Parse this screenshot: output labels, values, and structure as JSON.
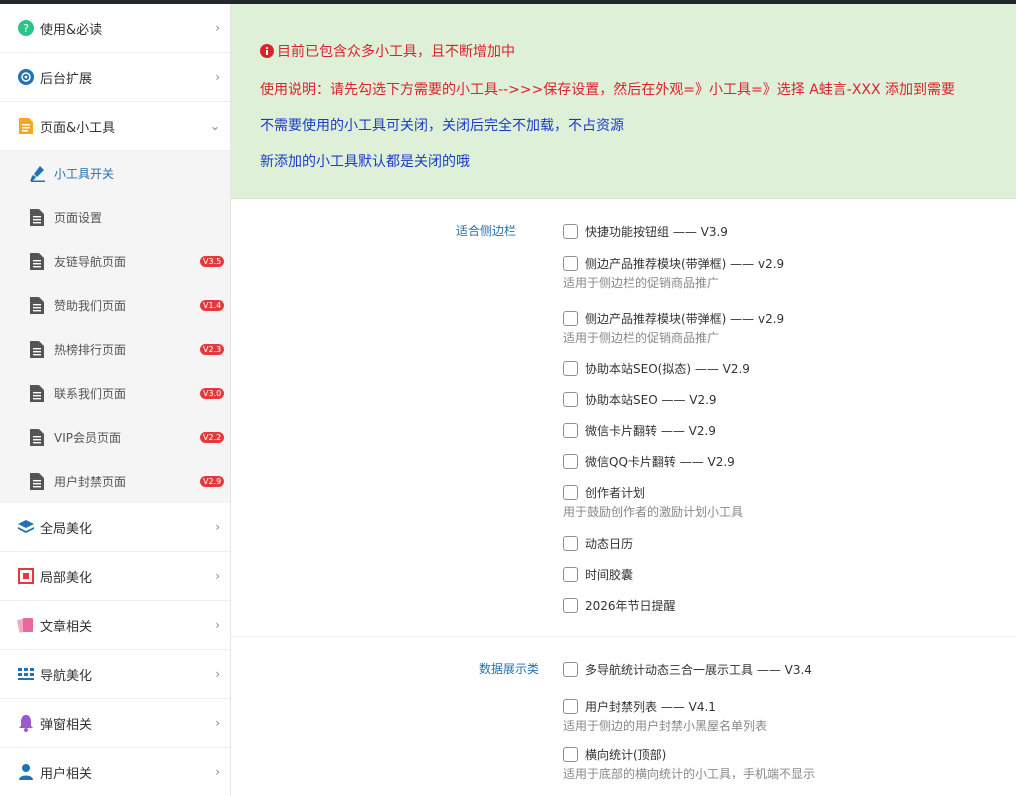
{
  "sidebar": {
    "items": [
      {
        "label": "使用&必读",
        "icon": "question-circle-icon",
        "color": "#2bc48a"
      },
      {
        "label": "后台扩展",
        "icon": "settings-circle-icon",
        "color": "#2271b1"
      },
      {
        "label": "页面&小工具",
        "icon": "document-icon",
        "color": "#f5a623"
      }
    ],
    "sub_items": [
      {
        "label": "小工具开关",
        "badge": "",
        "active": true
      },
      {
        "label": "页面设置",
        "badge": ""
      },
      {
        "label": "友链导航页面",
        "badge": "V3.5"
      },
      {
        "label": "赞助我们页面",
        "badge": "V1.4"
      },
      {
        "label": "热榜排行页面",
        "badge": "V2.3"
      },
      {
        "label": "联系我们页面",
        "badge": "V3.0"
      },
      {
        "label": "VIP会员页面",
        "badge": "V2.2"
      },
      {
        "label": "用户封禁页面",
        "badge": "V2.9"
      }
    ],
    "items_after": [
      {
        "label": "全局美化",
        "icon": "layers-icon",
        "color": "#2271b1"
      },
      {
        "label": "局部美化",
        "icon": "frame-icon",
        "color": "#e4393c"
      },
      {
        "label": "文章相关",
        "icon": "cards-icon",
        "color": "#e66a9f"
      },
      {
        "label": "导航美化",
        "icon": "grid-icon",
        "color": "#2271b1"
      },
      {
        "label": "弹窗相关",
        "icon": "bell-icon",
        "color": "#9b59d0"
      },
      {
        "label": "用户相关",
        "icon": "user-icon",
        "color": "#2271b1"
      }
    ]
  },
  "notice": {
    "line1": "目前已包含众多小工具，且不断增加中",
    "line2": "使用说明：请先勾选下方需要的小工具-->>>保存设置，然后在外观=》小工具=》选择 A蛙言-XXX 添加到需要",
    "line3": "不需要使用的小工具可关闭，关闭后完全不加载，不占资源",
    "line4": "新添加的小工具默认都是关闭的哦"
  },
  "groups": [
    {
      "label": "适合侧边栏",
      "items": [
        {
          "label": "快捷功能按钮组 —— V3.9",
          "desc": ""
        },
        {
          "label": "侧边产品推荐模块(带弹框) —— v2.9",
          "desc": "适用于侧边栏的促销商品推广"
        },
        {
          "label": "侧边产品推荐模块(带弹框) —— v2.9",
          "desc": "适用于侧边栏的促销商品推广"
        },
        {
          "label": "协助本站SEO(拟态) —— V2.9",
          "desc": ""
        },
        {
          "label": "协助本站SEO —— V2.9",
          "desc": ""
        },
        {
          "label": "微信卡片翻转 —— V2.9",
          "desc": ""
        },
        {
          "label": "微信QQ卡片翻转 —— V2.9",
          "desc": ""
        },
        {
          "label": "创作者计划",
          "desc": "用于鼓励创作者的激励计划小工具"
        },
        {
          "label": "动态日历",
          "desc": ""
        },
        {
          "label": "时间胶囊",
          "desc": ""
        },
        {
          "label": "2026年节日提醒",
          "desc": ""
        }
      ]
    },
    {
      "label": "数据展示类",
      "items": [
        {
          "label": "多导航统计动态三合一展示工具 —— V3.4",
          "desc": ""
        },
        {
          "label": "用户封禁列表 —— V4.1",
          "desc": "适用于侧边的用户封禁小黑屋名单列表"
        },
        {
          "label": "横向统计(顶部)",
          "desc": "适用于底部的横向统计的小工具，手机端不显示"
        }
      ]
    }
  ]
}
